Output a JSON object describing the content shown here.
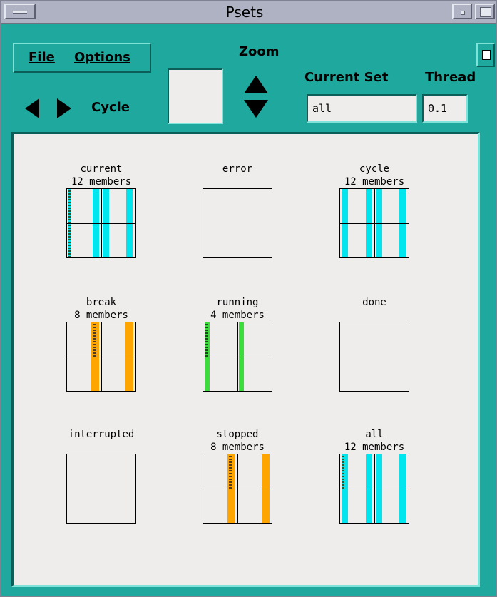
{
  "window": {
    "title": "Psets"
  },
  "menu": {
    "file_label": "File",
    "options_label": "Options"
  },
  "toolbar": {
    "cycle_label": "Cycle",
    "zoom_label": "Zoom",
    "current_set_label": "Current Set",
    "thread_label": "Thread",
    "current_set_value": "all",
    "thread_value": "0.1"
  },
  "colors": {
    "cyan": "#00e5ee",
    "orange": "#ffa500",
    "green": "#3cdc3c",
    "panel_bg": "#efedec",
    "frame": "#1fa99e"
  },
  "psets": [
    {
      "name": "current",
      "members": "12 members",
      "color": "cyan"
    },
    {
      "name": "error",
      "members": "",
      "color": ""
    },
    {
      "name": "cycle",
      "members": "12 members",
      "color": "cyan"
    },
    {
      "name": "break",
      "members": "8 members",
      "color": "orange"
    },
    {
      "name": "running",
      "members": "4 members",
      "color": "green"
    },
    {
      "name": "done",
      "members": "",
      "color": ""
    },
    {
      "name": "interrupted",
      "members": "",
      "color": ""
    },
    {
      "name": "stopped",
      "members": "8 members",
      "color": "orange"
    },
    {
      "name": "all",
      "members": "12 members",
      "color": "cyan"
    }
  ]
}
